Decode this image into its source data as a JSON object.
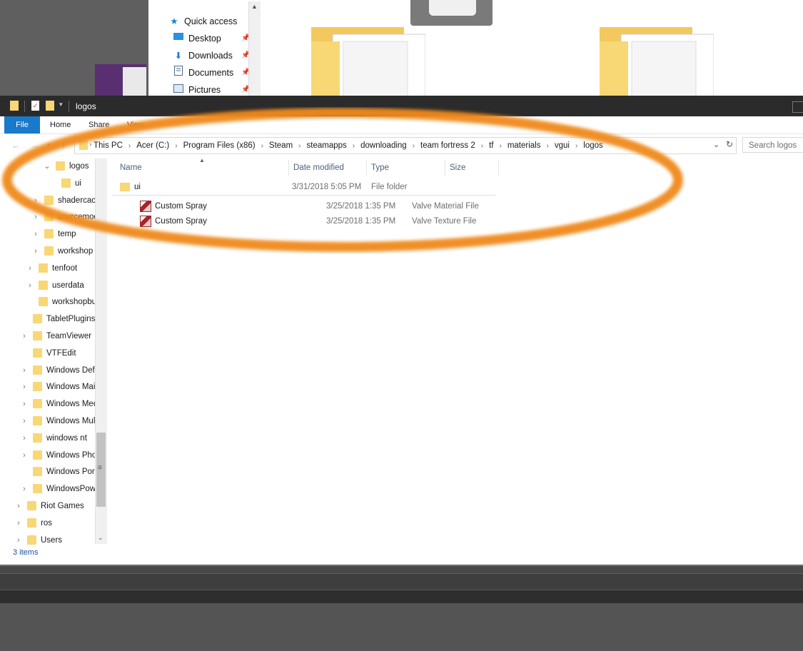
{
  "background_window": {
    "quick_access": [
      {
        "label": "Quick access",
        "icon": "star-icon",
        "pinned": false
      },
      {
        "label": "Desktop",
        "icon": "desktop-icon",
        "pinned": true
      },
      {
        "label": "Downloads",
        "icon": "download-arrow-icon",
        "pinned": true
      },
      {
        "label": "Documents",
        "icon": "document-icon",
        "pinned": true
      },
      {
        "label": "Pictures",
        "icon": "pictures-icon",
        "pinned": true
      }
    ]
  },
  "window": {
    "title": "logos"
  },
  "ribbon": {
    "tabs": [
      "File",
      "Home",
      "Share",
      "View"
    ]
  },
  "address": {
    "breadcrumbs": [
      "This PC",
      "Acer (C:)",
      "Program Files (x86)",
      "Steam",
      "steamapps",
      "downloading",
      "team fortress 2",
      "tf",
      "materials",
      "vgui",
      "logos"
    ],
    "search_placeholder": "Search logos"
  },
  "nav_pane": {
    "items": [
      {
        "label": "logos",
        "indent": 5,
        "expanded": true
      },
      {
        "label": "ui",
        "indent": 6,
        "expanded": null
      },
      {
        "label": "shadercache",
        "indent": 3,
        "expanded": false
      },
      {
        "label": "sourcemods",
        "indent": 3,
        "expanded": false
      },
      {
        "label": "temp",
        "indent": 3,
        "expanded": false
      },
      {
        "label": "workshop",
        "indent": 3,
        "expanded": false
      },
      {
        "label": "tenfoot",
        "indent": 2,
        "expanded": false
      },
      {
        "label": "userdata",
        "indent": 2,
        "expanded": false
      },
      {
        "label": "workshopbuilds",
        "indent": 2,
        "expanded": null
      },
      {
        "label": "TabletPlugins",
        "indent": 1,
        "expanded": null
      },
      {
        "label": "TeamViewer",
        "indent": 1,
        "expanded": false
      },
      {
        "label": "VTFEdit",
        "indent": 1,
        "expanded": null
      },
      {
        "label": "Windows Defender",
        "indent": 1,
        "expanded": false
      },
      {
        "label": "Windows Mail",
        "indent": 1,
        "expanded": false
      },
      {
        "label": "Windows Media Player",
        "indent": 1,
        "expanded": false
      },
      {
        "label": "Windows Multimedia Platform",
        "indent": 1,
        "expanded": false
      },
      {
        "label": "windows nt",
        "indent": 1,
        "expanded": false
      },
      {
        "label": "Windows Photo Viewer",
        "indent": 1,
        "expanded": false
      },
      {
        "label": "Windows Portable Devices",
        "indent": 1,
        "expanded": null
      },
      {
        "label": "WindowsPowerShell",
        "indent": 1,
        "expanded": false
      },
      {
        "label": "Riot Games",
        "indent": 0,
        "expanded": false
      },
      {
        "label": "ros",
        "indent": 0,
        "expanded": false
      },
      {
        "label": "Users",
        "indent": 0,
        "expanded": false
      }
    ]
  },
  "file_list": {
    "columns": [
      "Name",
      "Date modified",
      "Type",
      "Size"
    ],
    "rows": [
      {
        "name": "ui",
        "date": "3/31/2018 5:05 PM",
        "type": "File folder",
        "size": "",
        "icon": "folder-icon"
      },
      {
        "name": "Custom Spray",
        "date": "3/25/2018 1:35 PM",
        "type": "Valve Material File",
        "size": "",
        "icon": "vmt-file-icon"
      },
      {
        "name": "Custom Spray",
        "date": "3/25/2018 1:35 PM",
        "type": "Valve Texture File",
        "size": "",
        "icon": "vtf-file-icon"
      }
    ]
  },
  "status_bar": {
    "item_count": "3 items"
  },
  "colors": {
    "highlight_ellipse": "#f08a1c",
    "file_tab": "#1979ca",
    "folder": "#f8d775",
    "titlebar": "#2b2b2b"
  }
}
